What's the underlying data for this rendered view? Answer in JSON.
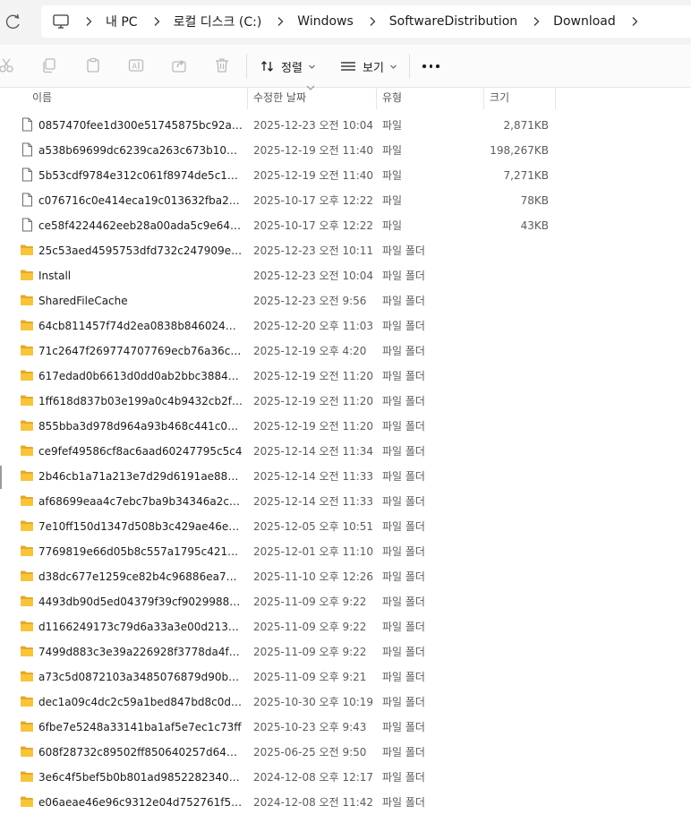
{
  "address": {
    "crumbs": [
      {
        "label": "내 PC"
      },
      {
        "label": "로컬 디스크 (C:)"
      },
      {
        "label": "Windows"
      },
      {
        "label": "SoftwareDistribution"
      },
      {
        "label": "Download"
      }
    ]
  },
  "toolbar": {
    "sort_label": "정렬",
    "view_label": "보기"
  },
  "columns": {
    "name": "이름",
    "date": "수정한 날짜",
    "type": "유형",
    "size": "크기"
  },
  "files": [
    {
      "icon": "file-icon",
      "name": "0857470fee1d300e51745875bc92a9cc...",
      "date": "2025-12-23 오전 10:04",
      "type": "파일",
      "size": "2,871KB"
    },
    {
      "icon": "file-icon",
      "name": "a538b69699dc6239ca263c673b10b95...",
      "date": "2025-12-19 오전 11:40",
      "type": "파일",
      "size": "198,267KB"
    },
    {
      "icon": "file-icon",
      "name": "5b53cdf9784e312c061f8974de5c12da...",
      "date": "2025-12-19 오전 11:40",
      "type": "파일",
      "size": "7,271KB"
    },
    {
      "icon": "file-icon",
      "name": "c076716c0e414eca19c013632fba2027...",
      "date": "2025-10-17 오후 12:22",
      "type": "파일",
      "size": "78KB"
    },
    {
      "icon": "file-icon",
      "name": "ce58f4224462eeb28a00ada5c9e643e9...",
      "date": "2025-10-17 오후 12:22",
      "type": "파일",
      "size": "43KB"
    },
    {
      "icon": "folder-icon",
      "name": "25c53aed4595753dfd732c247909ee31",
      "date": "2025-12-23 오전 10:11",
      "type": "파일 폴더",
      "size": ""
    },
    {
      "icon": "folder-icon",
      "name": "Install",
      "date": "2025-12-23 오전 10:04",
      "type": "파일 폴더",
      "size": ""
    },
    {
      "icon": "folder-icon",
      "name": "SharedFileCache",
      "date": "2025-12-23 오전 9:56",
      "type": "파일 폴더",
      "size": ""
    },
    {
      "icon": "folder-icon",
      "name": "64cb811457f74d2ea0838b8460241c1b",
      "date": "2025-12-20 오후 11:03",
      "type": "파일 폴더",
      "size": ""
    },
    {
      "icon": "folder-icon",
      "name": "71c2647f269774707769ecb76a36c33c",
      "date": "2025-12-19 오후 4:20",
      "type": "파일 폴더",
      "size": ""
    },
    {
      "icon": "folder-icon",
      "name": "617edad0b6613d0dd0ab2bbc38848ccb",
      "date": "2025-12-19 오전 11:20",
      "type": "파일 폴더",
      "size": ""
    },
    {
      "icon": "folder-icon",
      "name": "1ff618d837b03e199a0c4b9432cb2f79",
      "date": "2025-12-19 오전 11:20",
      "type": "파일 폴더",
      "size": ""
    },
    {
      "icon": "folder-icon",
      "name": "855bba3d978d964a93b468c441c00816",
      "date": "2025-12-19 오전 11:20",
      "type": "파일 폴더",
      "size": ""
    },
    {
      "icon": "folder-icon",
      "name": "ce9fef49586cf8ac6aad60247795c5c4",
      "date": "2025-12-14 오전 11:34",
      "type": "파일 폴더",
      "size": ""
    },
    {
      "icon": "folder-icon",
      "name": "2b46cb1a71a213e7d29d6191ae883e43",
      "date": "2025-12-14 오전 11:33",
      "type": "파일 폴더",
      "size": ""
    },
    {
      "icon": "folder-icon",
      "name": "af68699eaa4c7ebc7ba9b34346a2cece",
      "date": "2025-12-14 오전 11:33",
      "type": "파일 폴더",
      "size": ""
    },
    {
      "icon": "folder-icon",
      "name": "7e10ff150d1347d508b3c429ae46e260",
      "date": "2025-12-05 오후 10:51",
      "type": "파일 폴더",
      "size": ""
    },
    {
      "icon": "folder-icon",
      "name": "7769819e66d05b8c557a1795c4211c26",
      "date": "2025-12-01 오후 11:10",
      "type": "파일 폴더",
      "size": ""
    },
    {
      "icon": "folder-icon",
      "name": "d38dc677e1259ce82b4c96886ea7a318",
      "date": "2025-11-10 오후 12:26",
      "type": "파일 폴더",
      "size": ""
    },
    {
      "icon": "folder-icon",
      "name": "4493db90d5ed04379f39cf9029988d44",
      "date": "2025-11-09 오후 9:22",
      "type": "파일 폴더",
      "size": ""
    },
    {
      "icon": "folder-icon",
      "name": "d1166249173c79d6a33a3e00d21349db",
      "date": "2025-11-09 오후 9:22",
      "type": "파일 폴더",
      "size": ""
    },
    {
      "icon": "folder-icon",
      "name": "7499d883c3e39a226928f3778da4f602",
      "date": "2025-11-09 오후 9:22",
      "type": "파일 폴더",
      "size": ""
    },
    {
      "icon": "folder-icon",
      "name": "a73c5d0872103a3485076879d90bb1f8",
      "date": "2025-11-09 오후 9:21",
      "type": "파일 폴더",
      "size": ""
    },
    {
      "icon": "folder-icon",
      "name": "dec1a09c4dc2c59a1bed847bd8c0d2d4",
      "date": "2025-10-30 오후 10:19",
      "type": "파일 폴더",
      "size": ""
    },
    {
      "icon": "folder-icon",
      "name": "6fbe7e5248a33141ba1af5e7ec1c73ff",
      "date": "2025-10-23 오후 9:43",
      "type": "파일 폴더",
      "size": ""
    },
    {
      "icon": "folder-icon",
      "name": "608f28732c89502ff850640257d641ea",
      "date": "2025-06-25 오전 9:50",
      "type": "파일 폴더",
      "size": ""
    },
    {
      "icon": "folder-icon",
      "name": "3e6c4f5bef5b0b801ad9852282340e4c",
      "date": "2024-12-08 오후 12:17",
      "type": "파일 폴더",
      "size": ""
    },
    {
      "icon": "folder-icon",
      "name": "e06aeae46e96c9312e04d752761f53bd",
      "date": "2024-12-08 오전 11:42",
      "type": "파일 폴더",
      "size": ""
    }
  ],
  "colors": {
    "folder": "#f8c43a",
    "folder_dark": "#e5a82a",
    "text": "#1b1b1b",
    "muted": "#5c5c5c",
    "icon_disabled": "#b9b9b9"
  }
}
